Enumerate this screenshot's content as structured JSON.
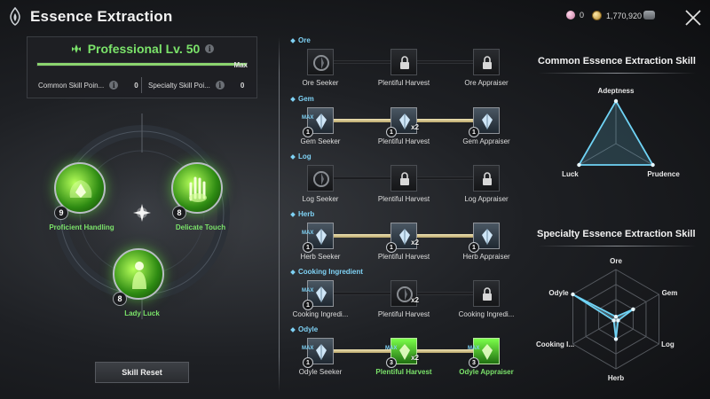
{
  "header": {
    "title": "Essence Extraction",
    "gem_count": "0",
    "gold_count": "1,770,920"
  },
  "profession": {
    "title": "Professional Lv. 50",
    "max_label": "Max",
    "progress": 1.0,
    "common_points_label": "Common Skill Poin...",
    "common_points_value": "0",
    "specialty_points_label": "Specialty Skill Poi...",
    "specialty_points_value": "0"
  },
  "skills": [
    {
      "name": "Proficient Handling",
      "level": "9"
    },
    {
      "name": "Delicate Touch",
      "level": "8"
    },
    {
      "name": "Lady Luck",
      "level": "8"
    }
  ],
  "reset_label": "Skill Reset",
  "tree": [
    {
      "category": "Ore",
      "nodes": [
        {
          "name": "Ore Seeker",
          "state": "owned",
          "level": "",
          "max": false,
          "x2": false
        },
        {
          "name": "Plentiful Harvest",
          "state": "locked",
          "level": "",
          "max": false,
          "x2": false
        },
        {
          "name": "Ore Appraiser",
          "state": "locked",
          "level": "",
          "max": false,
          "x2": false
        }
      ],
      "links": [
        false,
        false
      ]
    },
    {
      "category": "Gem",
      "nodes": [
        {
          "name": "Gem Seeker",
          "state": "active",
          "level": "1",
          "max": true,
          "x2": false
        },
        {
          "name": "Plentiful Harvest",
          "state": "active",
          "level": "1",
          "max": false,
          "x2": true
        },
        {
          "name": "Gem Appraiser",
          "state": "active",
          "level": "1",
          "max": false,
          "x2": false
        }
      ],
      "links": [
        true,
        true
      ]
    },
    {
      "category": "Log",
      "nodes": [
        {
          "name": "Log Seeker",
          "state": "owned",
          "level": "",
          "max": false,
          "x2": false
        },
        {
          "name": "Plentiful Harvest",
          "state": "locked",
          "level": "",
          "max": false,
          "x2": false
        },
        {
          "name": "Log Appraiser",
          "state": "locked",
          "level": "",
          "max": false,
          "x2": false
        }
      ],
      "links": [
        false,
        false
      ]
    },
    {
      "category": "Herb",
      "nodes": [
        {
          "name": "Herb Seeker",
          "state": "active",
          "level": "1",
          "max": true,
          "x2": false
        },
        {
          "name": "Plentiful Harvest",
          "state": "active",
          "level": "1",
          "max": false,
          "x2": true
        },
        {
          "name": "Herb Appraiser",
          "state": "active",
          "level": "1",
          "max": false,
          "x2": false
        }
      ],
      "links": [
        true,
        true
      ]
    },
    {
      "category": "Cooking Ingredient",
      "nodes": [
        {
          "name": "Cooking Ingredi...",
          "state": "active",
          "level": "1",
          "max": true,
          "x2": false
        },
        {
          "name": "Plentiful Harvest",
          "state": "owned",
          "level": "",
          "max": false,
          "x2": true
        },
        {
          "name": "Cooking Ingredi...",
          "state": "locked",
          "level": "",
          "max": false,
          "x2": false
        }
      ],
      "links": [
        false,
        false
      ]
    },
    {
      "category": "Odyle",
      "nodes": [
        {
          "name": "Odyle Seeker",
          "state": "active",
          "level": "1",
          "max": true,
          "x2": false
        },
        {
          "name": "Plentiful Harvest",
          "state": "green",
          "level": "3",
          "max": true,
          "x2": true
        },
        {
          "name": "Odyle Appraiser",
          "state": "green",
          "level": "3",
          "max": true,
          "x2": false
        }
      ],
      "links": [
        true,
        true
      ]
    }
  ],
  "max_badge": "MAX",
  "x2_badge": "x2",
  "chart_data": [
    {
      "type": "radar",
      "title": "Common Essence Extraction Skill",
      "axes": [
        "Adeptness",
        "Prudence",
        "Luck"
      ],
      "values": [
        1.0,
        1.0,
        1.0
      ],
      "range": [
        0,
        1
      ],
      "color": "#6fd3f5"
    },
    {
      "type": "radar",
      "title": "Specialty Essence Extraction Skill",
      "axes": [
        "Ore",
        "Gem",
        "Log",
        "Herb",
        "Cooking I...",
        "Odyle"
      ],
      "values": [
        0.05,
        0.4,
        0.05,
        0.4,
        0.05,
        1.0
      ],
      "range": [
        0,
        1
      ],
      "color": "#6fd3f5"
    }
  ]
}
